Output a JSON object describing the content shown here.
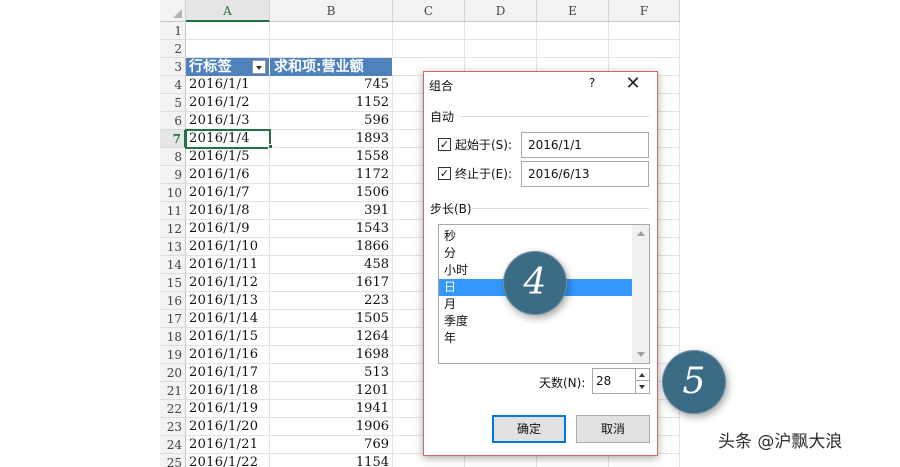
{
  "sheet": {
    "columns": [
      "A",
      "B",
      "C",
      "D",
      "E",
      "F"
    ],
    "header": {
      "row_label": "行标签",
      "value_label": "求和项:营业额"
    },
    "rows": [
      {
        "n": "1",
        "date": "",
        "value": ""
      },
      {
        "n": "2",
        "date": "",
        "value": ""
      },
      {
        "n": "3",
        "date": "",
        "value": ""
      },
      {
        "n": "4",
        "date": "2016/1/1",
        "value": "745"
      },
      {
        "n": "5",
        "date": "2016/1/2",
        "value": "1152"
      },
      {
        "n": "6",
        "date": "2016/1/3",
        "value": "596"
      },
      {
        "n": "7",
        "date": "2016/1/4",
        "value": "1893"
      },
      {
        "n": "8",
        "date": "2016/1/5",
        "value": "1558"
      },
      {
        "n": "9",
        "date": "2016/1/6",
        "value": "1172"
      },
      {
        "n": "10",
        "date": "2016/1/7",
        "value": "1506"
      },
      {
        "n": "11",
        "date": "2016/1/8",
        "value": "391"
      },
      {
        "n": "12",
        "date": "2016/1/9",
        "value": "1543"
      },
      {
        "n": "13",
        "date": "2016/1/10",
        "value": "1866"
      },
      {
        "n": "14",
        "date": "2016/1/11",
        "value": "458"
      },
      {
        "n": "15",
        "date": "2016/1/12",
        "value": "1617"
      },
      {
        "n": "16",
        "date": "2016/1/13",
        "value": "223"
      },
      {
        "n": "17",
        "date": "2016/1/14",
        "value": "1505"
      },
      {
        "n": "18",
        "date": "2016/1/15",
        "value": "1264"
      },
      {
        "n": "19",
        "date": "2016/1/16",
        "value": "1698"
      },
      {
        "n": "20",
        "date": "2016/1/17",
        "value": "513"
      },
      {
        "n": "21",
        "date": "2016/1/18",
        "value": "1201"
      },
      {
        "n": "22",
        "date": "2016/1/19",
        "value": "1941"
      },
      {
        "n": "23",
        "date": "2016/1/20",
        "value": "1906"
      },
      {
        "n": "24",
        "date": "2016/1/21",
        "value": "769"
      },
      {
        "n": "25",
        "date": "2016/1/22",
        "value": "1154"
      }
    ],
    "active_cell": "A7",
    "header_color": "#4f81bd",
    "accent_color": "#217346"
  },
  "dialog": {
    "title": "组合",
    "help": "?",
    "close": "✕",
    "auto_label": "自动",
    "start": {
      "label": "起始于(S):",
      "checked": true,
      "value": "2016/1/1"
    },
    "end": {
      "label": "终止于(E):",
      "checked": true,
      "value": "2016/6/13"
    },
    "step_label": "步长(B)",
    "units": [
      "秒",
      "分",
      "小时",
      "日",
      "月",
      "季度",
      "年"
    ],
    "selected_unit": "日",
    "days_label": "天数(N):",
    "days_value": "28",
    "ok": "确定",
    "cancel": "取消",
    "selection_color": "#3399ff"
  },
  "callouts": [
    "4",
    "5"
  ],
  "watermark": "头条 @沪飘大浪"
}
